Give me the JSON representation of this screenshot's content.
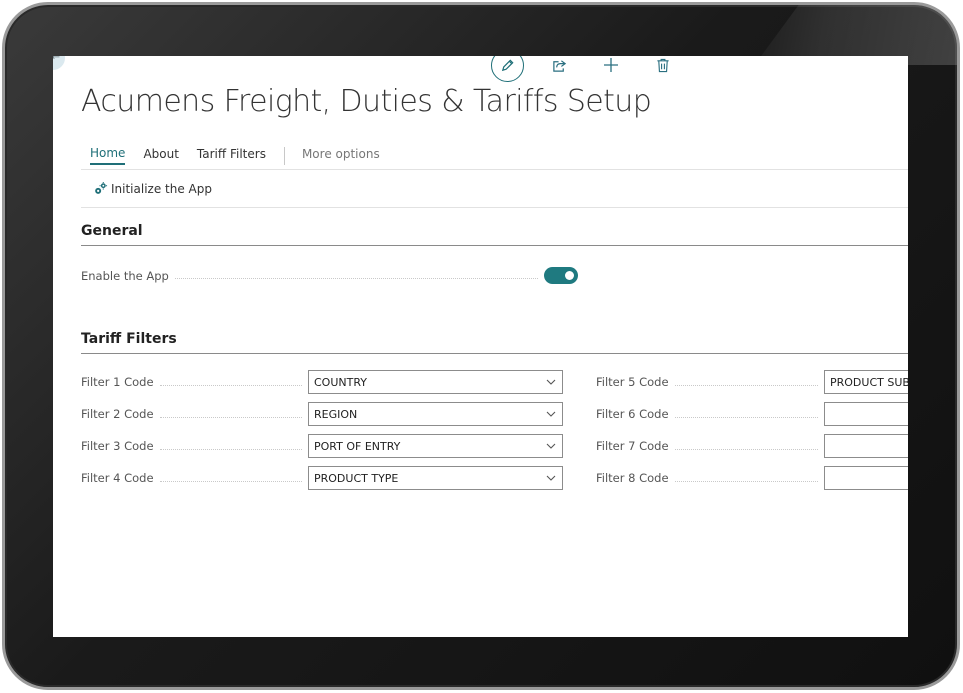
{
  "page": {
    "title": "Acumens Freight, Duties & Tariffs Setup"
  },
  "tabs": [
    {
      "label": "Home",
      "active": true
    },
    {
      "label": "About"
    },
    {
      "label": "Tariff Filters"
    },
    {
      "label": "More options"
    }
  ],
  "actions": {
    "initialize_label": "Initialize the App"
  },
  "top_icons": [
    "edit-icon",
    "share-icon",
    "plus-icon",
    "trash-icon"
  ],
  "general": {
    "title": "General",
    "enable_label": "Enable the App",
    "enabled": true
  },
  "tariff_filters": {
    "title": "Tariff Filters",
    "left": [
      {
        "label": "Filter 1 Code",
        "value": "COUNTRY"
      },
      {
        "label": "Filter 2 Code",
        "value": "REGION"
      },
      {
        "label": "Filter 3 Code",
        "value": "PORT OF ENTRY"
      },
      {
        "label": "Filter 4 Code",
        "value": "PRODUCT TYPE"
      }
    ],
    "right": [
      {
        "label": "Filter 5 Code",
        "value": "PRODUCT SUB-"
      },
      {
        "label": "Filter 6 Code",
        "value": ""
      },
      {
        "label": "Filter 7 Code",
        "value": ""
      },
      {
        "label": "Filter 8 Code",
        "value": ""
      }
    ]
  },
  "colors": {
    "accent": "#1f6f78",
    "toggle_on": "#1f7a80"
  }
}
